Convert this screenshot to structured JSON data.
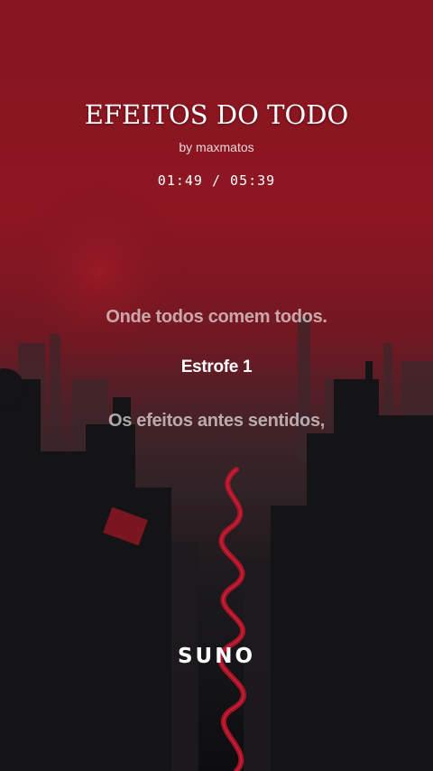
{
  "song": {
    "title": "EFEITOS DO TODO",
    "artist": "by maxmatos",
    "time": "01:49 / 05:39"
  },
  "lyrics": {
    "previous": "Onde todos comem todos.",
    "current": "Estrofe 1",
    "next": "Os efeitos antes sentidos,"
  },
  "brand": {
    "logo_text": "SUNO"
  },
  "colors": {
    "background_top": "#8a1722",
    "background_bottom": "#0e0e10",
    "accent_red": "#b3142a",
    "text": "#ffffff"
  }
}
